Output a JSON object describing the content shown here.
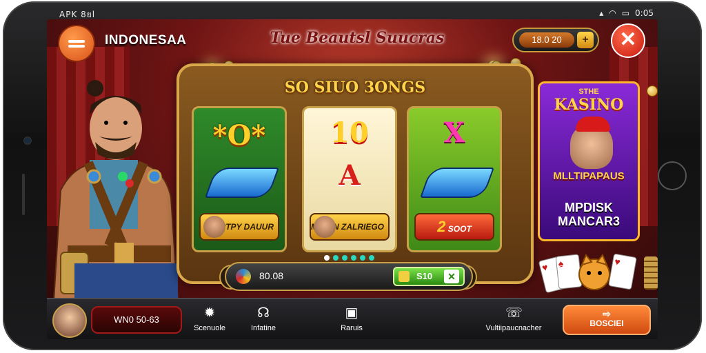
{
  "status_bar": {
    "left_text": "APK 8ยl",
    "time": "0:05"
  },
  "header": {
    "brand": "INDONESAA",
    "title": "Tue Beautsl Suucras",
    "balance": "18.0 20",
    "balance_plus": "+",
    "close_icon": "close-icon",
    "menu_icon": "menu-icon"
  },
  "machine": {
    "title": "SO SIUO 3ONGS",
    "reels": [
      {
        "top_symbol": "*O*",
        "bottom_plaque": "ARTPY DAUUR"
      },
      {
        "top_symbol": "10",
        "middle_symbol": "A",
        "bottom_plaque": "MUMIN ZALRIEGO"
      },
      {
        "top_symbol": "X",
        "bottom_plaque": "SOOT",
        "plaque_prefix": "2"
      }
    ],
    "page_dots": 6
  },
  "spin_bar": {
    "amount": "80.08",
    "spin_label": "S10"
  },
  "promo": {
    "line1": "STHE",
    "line2": "KASINO",
    "line3": "MLLTIPAPAUS",
    "line4a": "MPDISK",
    "line4b": "MANCAR3"
  },
  "bottom_bar": {
    "user_id": "WN0 50-63",
    "items": [
      {
        "label": "Scenuole",
        "icon": "gear-icon"
      },
      {
        "label": "Infatine",
        "icon": "headset-icon"
      },
      {
        "label": "Raruis",
        "icon": "tablet-icon"
      },
      {
        "label": "Vultiipaucnacher",
        "icon": "support-icon"
      }
    ],
    "cta_label": "BOSCIEI"
  },
  "colors": {
    "accent_orange": "#d8521a",
    "gold": "#c9a04a",
    "close_red": "#c81a10"
  }
}
